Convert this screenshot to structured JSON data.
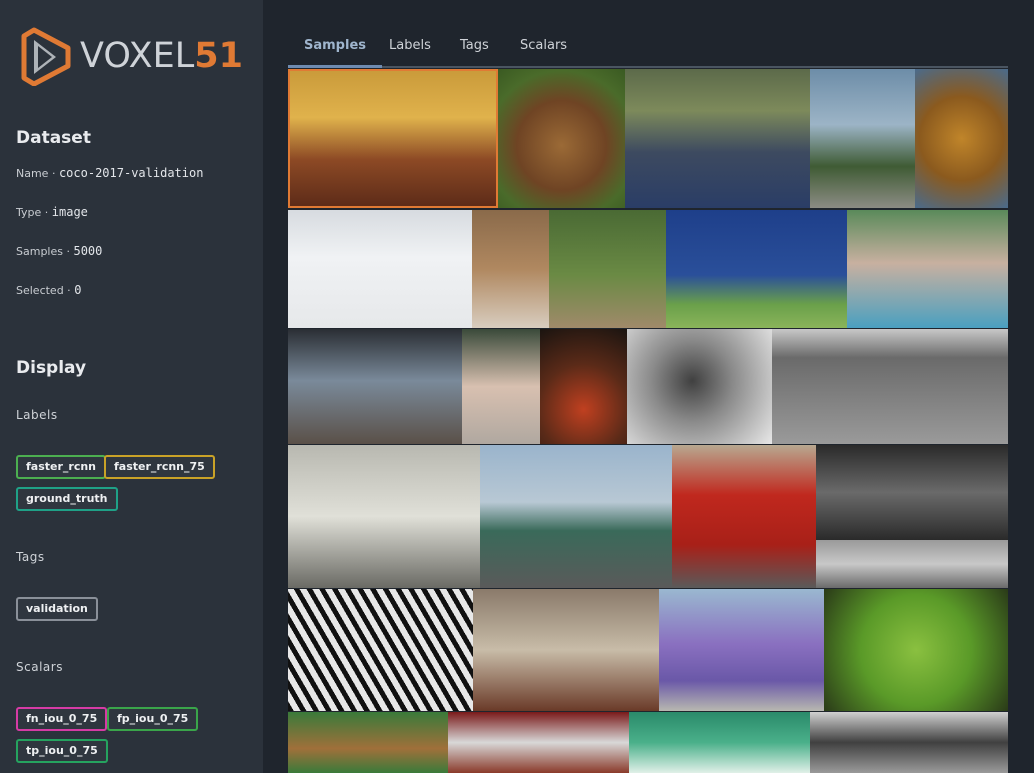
{
  "logo": {
    "text_main": "VOXEL",
    "text_num": "51"
  },
  "dataset": {
    "title": "Dataset",
    "name_label": "Name",
    "name_value": "coco-2017-validation",
    "type_label": "Type",
    "type_value": "image",
    "samples_label": "Samples",
    "samples_value": "5000",
    "selected_label": "Selected",
    "selected_value": "0"
  },
  "display": {
    "title": "Display",
    "labels_title": "Labels",
    "labels": [
      {
        "name": "faster_rcnn",
        "color": "#4caf50"
      },
      {
        "name": "faster_rcnn_75",
        "color": "#c9a227"
      },
      {
        "name": "ground_truth",
        "color": "#1fa187"
      }
    ],
    "tags_title": "Tags",
    "tags": [
      {
        "name": "validation",
        "color": "#8a9099"
      }
    ],
    "scalars_title": "Scalars",
    "scalars": [
      {
        "name": "fn_iou_0_75",
        "color": "#d63ba5"
      },
      {
        "name": "fp_iou_0_75",
        "color": "#3aa54a"
      },
      {
        "name": "tp_iou_0_75",
        "color": "#25a35f"
      }
    ]
  },
  "tabs": [
    "Samples",
    "Labels",
    "Tags",
    "Scalars"
  ],
  "active_tab": "Samples",
  "accent_color": "#e07a34"
}
